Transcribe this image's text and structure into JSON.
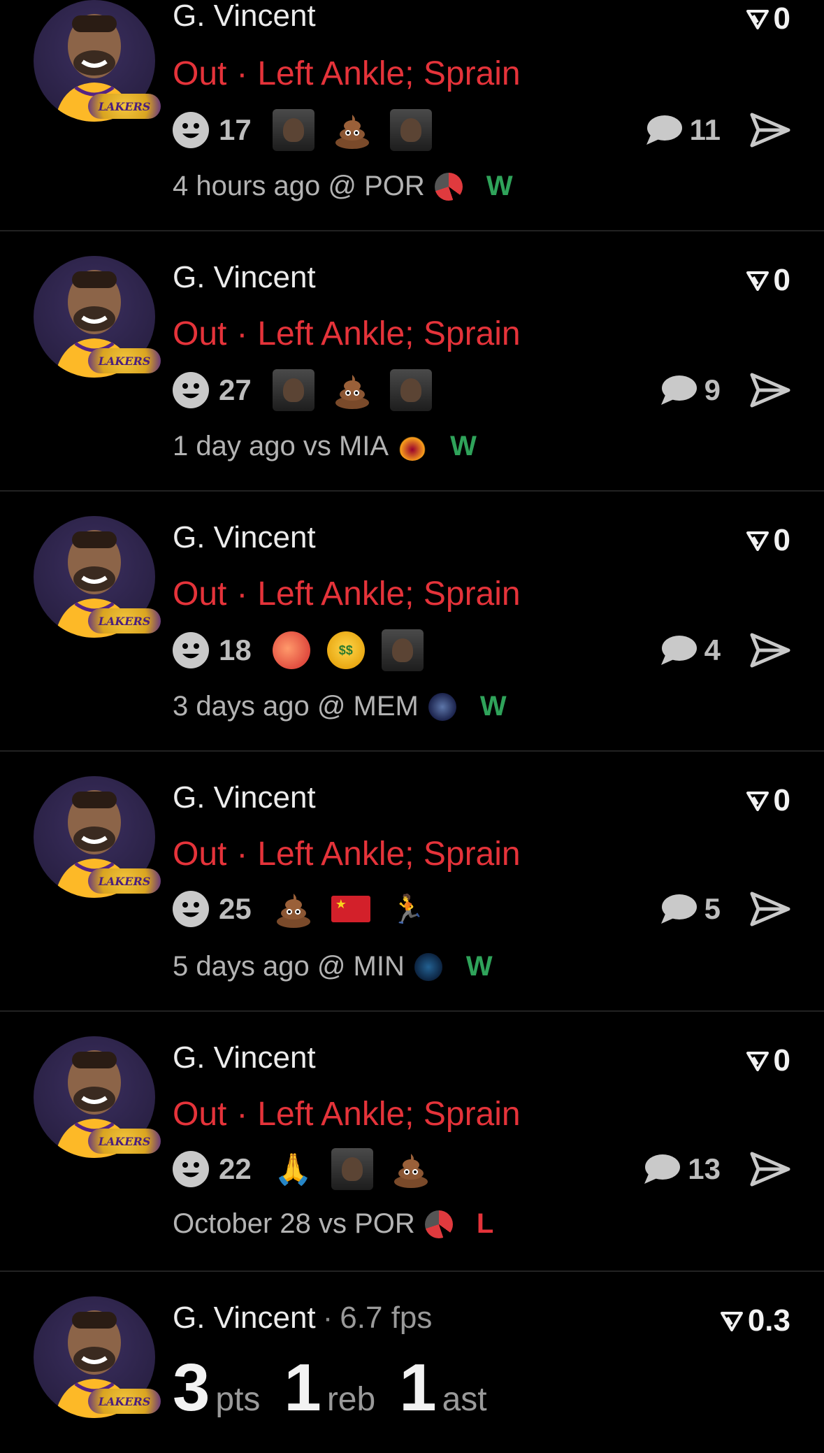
{
  "colors": {
    "background": "#000000",
    "status_red": "#e5333a",
    "win_green": "#2fa35a"
  },
  "cards": [
    {
      "name": "G. Vincent",
      "status": "Out",
      "injury": "Left Ankle; Sprain",
      "fantasy": "0",
      "reaction_count": "17",
      "emojis": [
        "photo-avatar",
        "poop",
        "photo-jersey"
      ],
      "comments": "11",
      "time": "4 hours ago",
      "matchup": "@ POR",
      "team_logo": "por",
      "result": "W"
    },
    {
      "name": "G. Vincent",
      "status": "Out",
      "injury": "Left Ankle; Sprain",
      "fantasy": "0",
      "reaction_count": "27",
      "emojis": [
        "photo-avatar",
        "poop",
        "photo-court"
      ],
      "comments": "9",
      "time": "1 day ago",
      "matchup": "vs MIA",
      "team_logo": "mia",
      "result": "W"
    },
    {
      "name": "G. Vincent",
      "status": "Out",
      "injury": "Left Ankle; Sprain",
      "fantasy": "0",
      "reaction_count": "18",
      "emojis": [
        "peach",
        "money-face",
        "photo-avatar"
      ],
      "comments": "4",
      "time": "3 days ago",
      "matchup": "@ MEM",
      "team_logo": "mem",
      "result": "W"
    },
    {
      "name": "G. Vincent",
      "status": "Out",
      "injury": "Left Ankle; Sprain",
      "fantasy": "0",
      "reaction_count": "25",
      "emojis": [
        "poop",
        "china-flag",
        "runner"
      ],
      "comments": "5",
      "time": "5 days ago",
      "matchup": "@ MIN",
      "team_logo": "min",
      "result": "W"
    },
    {
      "name": "G. Vincent",
      "status": "Out",
      "injury": "Left Ankle; Sprain",
      "fantasy": "0",
      "reaction_count": "22",
      "emojis": [
        "pray",
        "photo-avatar",
        "poop"
      ],
      "comments": "13",
      "time": "October 28",
      "matchup": "vs POR",
      "team_logo": "por",
      "result": "L"
    }
  ],
  "last_card": {
    "name": "G. Vincent",
    "fps": "6.7 fps",
    "fantasy": "0.3",
    "pts": "3",
    "pts_label": "pts",
    "reb": "1",
    "reb_label": "reb",
    "ast": "1",
    "ast_label": "ast"
  },
  "team_badge_text": "LAKERS"
}
